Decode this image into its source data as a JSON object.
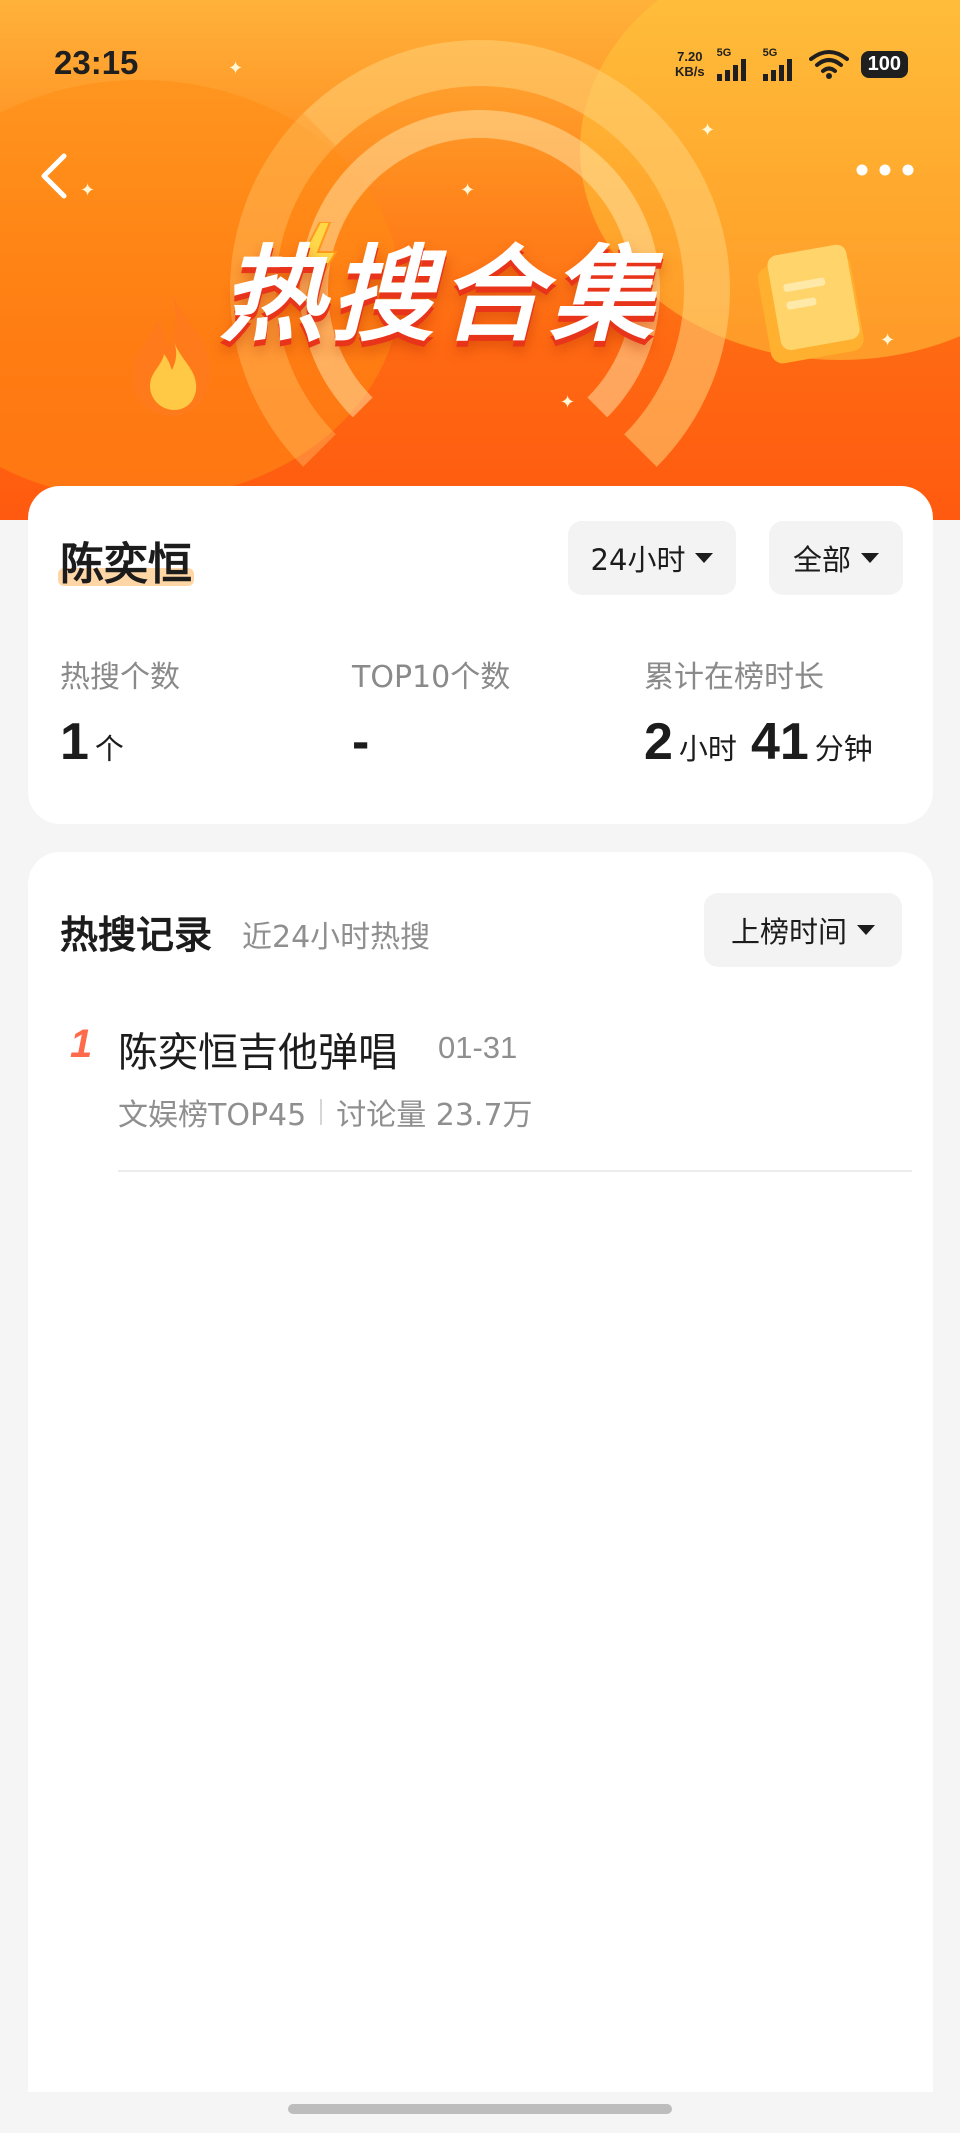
{
  "status_bar": {
    "time": "23:15",
    "net_speed_value": "7.20",
    "net_speed_unit": "KB/s",
    "signal1_label": "5G",
    "signal2_label": "5G",
    "battery": "100"
  },
  "banner": {
    "title": "热搜合集",
    "back_icon": "chevron-left-icon",
    "more_icon": "more-horizontal-icon",
    "colors": {
      "top": "#ffb23a",
      "bottom": "#ff5a10",
      "title_shadow": "#e8341a"
    }
  },
  "summary": {
    "name": "陈奕恒",
    "time_filter": "24小时",
    "scope_filter": "全部",
    "stats": [
      {
        "label": "热搜个数",
        "value": "1",
        "unit": "个"
      },
      {
        "label": "TOP10个数",
        "value": "-"
      },
      {
        "label": "累计在榜时长",
        "hours": "2",
        "hours_unit": "小时",
        "minutes": "41",
        "minutes_unit": "分钟"
      }
    ]
  },
  "records": {
    "title": "热搜记录",
    "subtitle": "近24小时热搜",
    "sort_label": "上榜时间",
    "items": [
      {
        "rank": "1",
        "title": "陈奕恒吉他弹唱",
        "date": "01-31",
        "board": "文娱榜TOP45",
        "discussion": "讨论量 23.7万"
      }
    ]
  },
  "accent_colors": {
    "rank": "#ff6a4a",
    "name_highlight": "#ffd7a6"
  }
}
